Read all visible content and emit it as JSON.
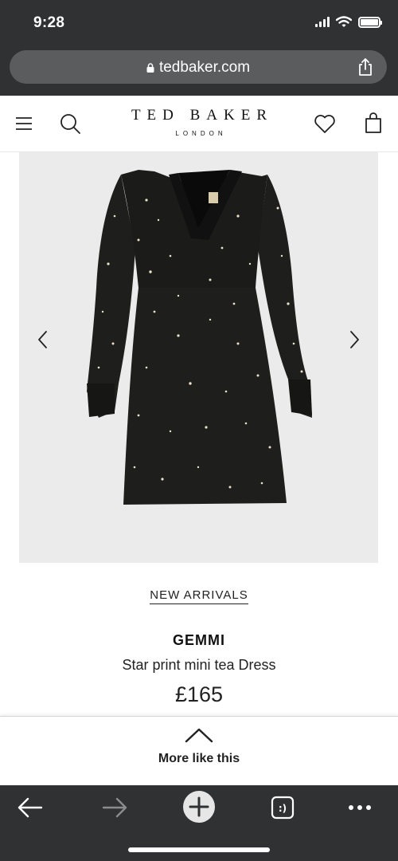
{
  "status_bar": {
    "time": "9:28",
    "icons": [
      "cellular-signal-icon",
      "wifi-icon",
      "battery-icon"
    ]
  },
  "browser": {
    "url": "tedbaker.com",
    "lock_icon": "lock-icon",
    "share_icon": "share-icon",
    "toolbar_icons": [
      "back-arrow-icon",
      "forward-arrow-icon",
      "new-tab-plus-icon",
      "tabs-icon",
      "more-dots-icon"
    ],
    "tabs_glyph": ":)"
  },
  "site_header": {
    "logo_main": "TED BAKER",
    "logo_sub": "LONDON",
    "icons": [
      "menu-icon",
      "search-icon",
      "heart-icon",
      "bag-icon"
    ]
  },
  "product": {
    "image_alt": "black star print mini tea dress",
    "category": "NEW ARRIVALS",
    "name": "GEMMI",
    "description": "Star print mini tea Dress",
    "price": "£165"
  },
  "more_like_this": {
    "label": "More like this"
  },
  "colors": {
    "browser_chrome": "#2f3133",
    "url_bar": "#5a5c5e",
    "image_background": "#ebebeb",
    "text": "#222222"
  }
}
